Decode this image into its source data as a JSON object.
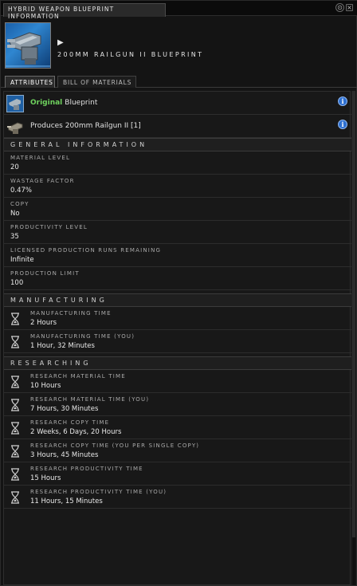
{
  "window": {
    "title": "HYBRID WEAPON BLUEPRINT INFORMATION",
    "buttons": [
      "⊙",
      "×"
    ]
  },
  "header": {
    "icon": "railgun-blueprint-icon",
    "item_name": "200MM RAILGUN II BLUEPRINT"
  },
  "tabs": [
    {
      "label": "ATTRIBUTES",
      "active": true
    },
    {
      "label": "BILL OF MATERIALS",
      "active": false
    }
  ],
  "summary": [
    {
      "prefix": "Original",
      "text": "Blueprint",
      "icon": "blueprint-icon",
      "accent": "#6fd25e"
    },
    {
      "prefix": "",
      "text": "Produces 200mm Railgun II [1]",
      "icon": "railgun-icon"
    }
  ],
  "sections": {
    "general": "GENERAL INFORMATION",
    "manufacturing": "MANUFACTURING",
    "researching": "RESEARCHING"
  },
  "general_info": [
    {
      "label": "MATERIAL LEVEL",
      "value": "20"
    },
    {
      "label": "WASTAGE FACTOR",
      "value": "0.47%"
    },
    {
      "label": "COPY",
      "value": "No"
    },
    {
      "label": "PRODUCTIVITY LEVEL",
      "value": "35"
    },
    {
      "label": "LICENSED PRODUCTION RUNS REMAINING",
      "value": "Infinite"
    },
    {
      "label": "PRODUCTION LIMIT",
      "value": "100"
    }
  ],
  "manufacturing": [
    {
      "label": "MANUFACTURING TIME",
      "value": "2 Hours"
    },
    {
      "label": "MANUFACTURING TIME (YOU)",
      "value": "1 Hour, 32 Minutes"
    }
  ],
  "researching": [
    {
      "label": "RESEARCH MATERIAL TIME",
      "value": "10 Hours"
    },
    {
      "label": "RESEARCH MATERIAL TIME (YOU)",
      "value": "7 Hours, 30 Minutes"
    },
    {
      "label": "RESEARCH COPY TIME",
      "value": "2 Weeks, 6 Days, 20 Hours"
    },
    {
      "label": "RESEARCH COPY TIME (YOU PER SINGLE COPY)",
      "value": "3 Hours, 45 Minutes"
    },
    {
      "label": "RESEARCH PRODUCTIVITY TIME",
      "value": "15 Hours"
    },
    {
      "label": "RESEARCH PRODUCTIVITY TIME (YOU)",
      "value": "11 Hours, 15 Minutes"
    }
  ],
  "colors": {
    "background": "#141414",
    "accent_green": "#6fd25e",
    "info_blue": "#2d6fd0"
  }
}
